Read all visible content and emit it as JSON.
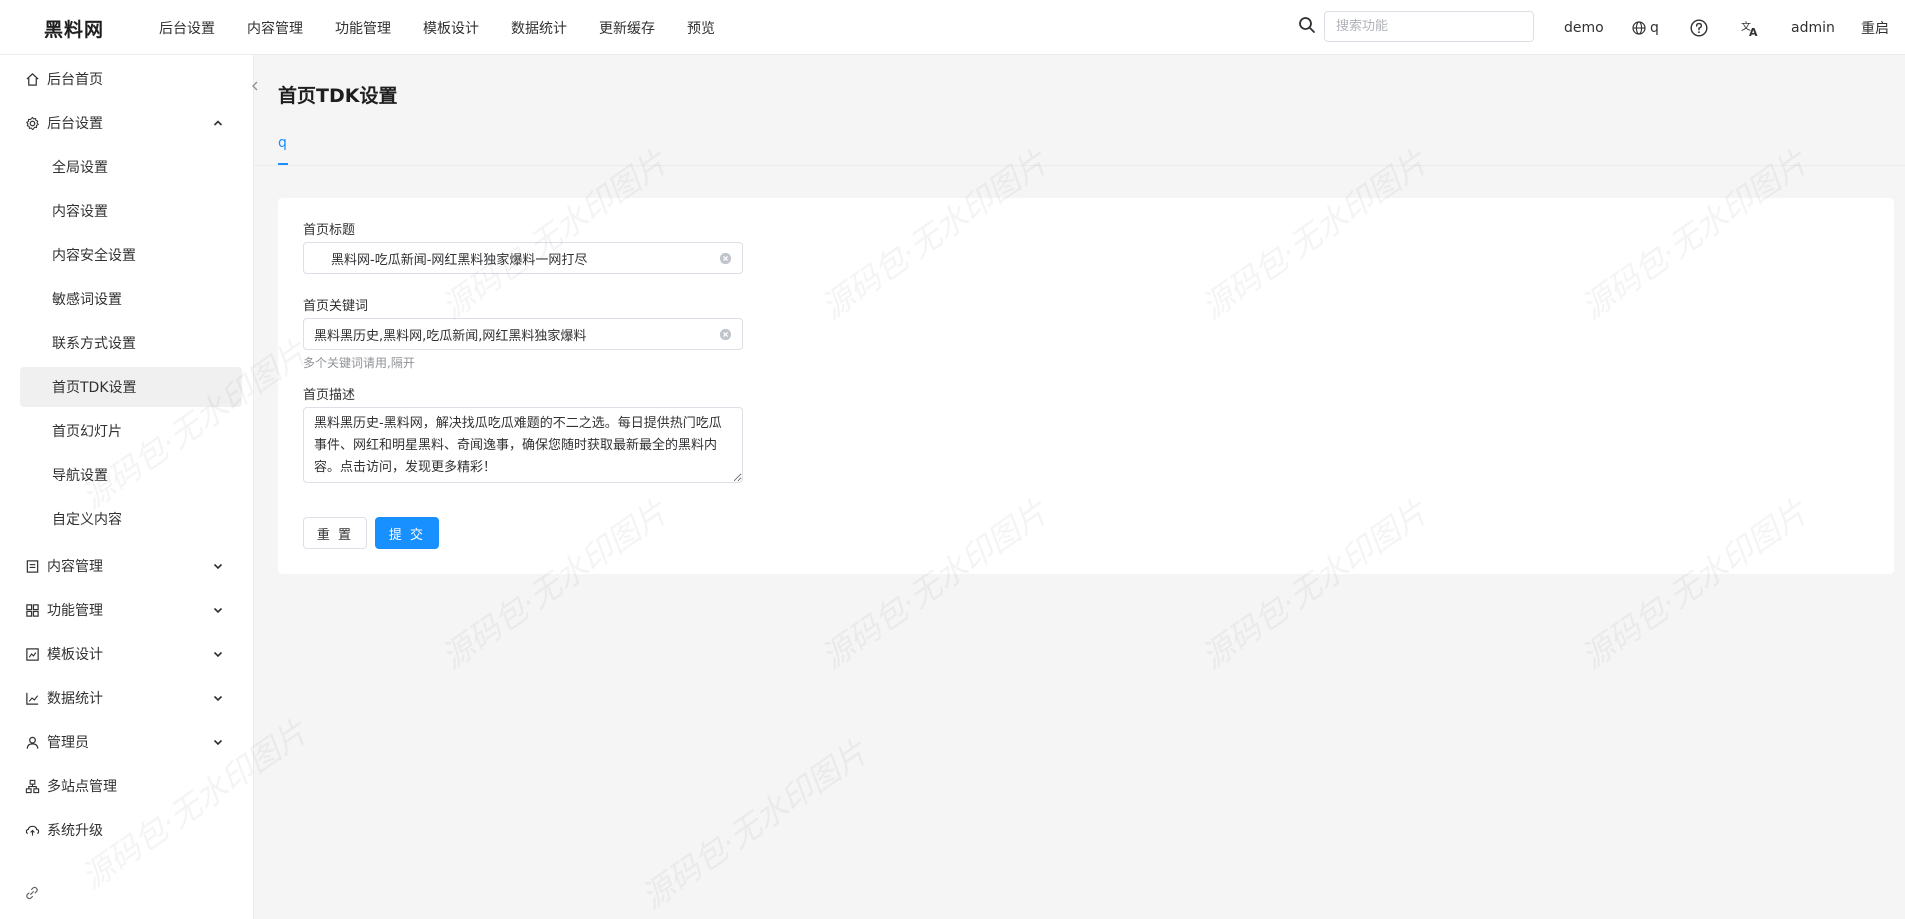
{
  "app": {
    "logo": "黑料网"
  },
  "top_nav": [
    "后台设置",
    "内容管理",
    "功能管理",
    "模板设计",
    "数据统计",
    "更新缓存",
    "预览"
  ],
  "search": {
    "placeholder": "搜索功能"
  },
  "top_right": {
    "site": "demo",
    "language": "q",
    "user": "admin",
    "restart": "重启"
  },
  "sidebar": {
    "items": [
      {
        "label": "后台首页",
        "icon": "home-icon"
      },
      {
        "label": "后台设置",
        "icon": "gear-icon",
        "expanded": true
      },
      {
        "label": "内容管理",
        "icon": "document-icon"
      },
      {
        "label": "功能管理",
        "icon": "grid-icon"
      },
      {
        "label": "模板设计",
        "icon": "template-icon"
      },
      {
        "label": "数据统计",
        "icon": "chart-icon"
      },
      {
        "label": "管理员",
        "icon": "user-icon"
      },
      {
        "label": "多站点管理",
        "icon": "sites-icon"
      },
      {
        "label": "系统升级",
        "icon": "upgrade-icon"
      }
    ],
    "sub_items": [
      "全局设置",
      "内容设置",
      "内容安全设置",
      "敏感词设置",
      "联系方式设置",
      "首页TDK设置",
      "首页幻灯片",
      "导航设置",
      "自定义内容"
    ],
    "active_sub": "首页TDK设置"
  },
  "page": {
    "title": "首页TDK设置",
    "tab": "q"
  },
  "form": {
    "title_label": "首页标题",
    "title_value": "黑料网-吃瓜新闻-网红黑料独家爆料一网打尽",
    "keywords_label": "首页关键词",
    "keywords_value": "黑料黑历史,黑料网,吃瓜新闻,网红黑料独家爆料",
    "keywords_hint": "多个关键词请用,隔开",
    "desc_label": "首页描述",
    "desc_value": "黑料黑历史-黑料网，解决找瓜吃瓜难题的不二之选。每日提供热门吃瓜事件、网红和明星黑料、奇闻逸事，确保您随时获取最新最全的黑料内容。点击访问，发现更多精彩！",
    "reset_label": "重 置",
    "submit_label": "提 交"
  },
  "colors": {
    "primary": "#1890ff",
    "active_bg": "#f0f0f0"
  }
}
